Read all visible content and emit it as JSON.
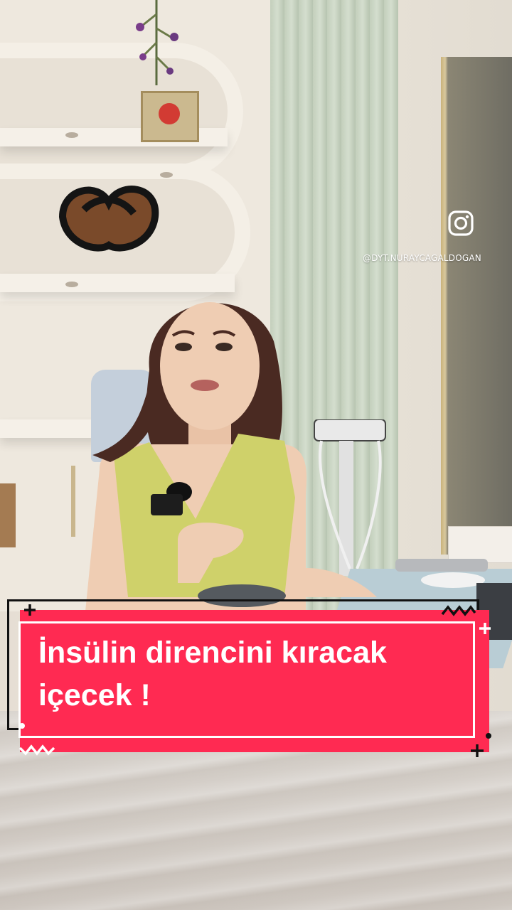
{
  "watermark": {
    "icon": "instagram-icon",
    "handle": "@DYT.NURAYCAGALDOGAN"
  },
  "caption": {
    "line1": "İnsülin direncini kıracak",
    "line2": "içecek !"
  },
  "colors": {
    "banner": "#ff2a52",
    "banner_border_inner": "#ffffff",
    "banner_border_outer": "#111111",
    "watermark_text": "#ffffff"
  }
}
